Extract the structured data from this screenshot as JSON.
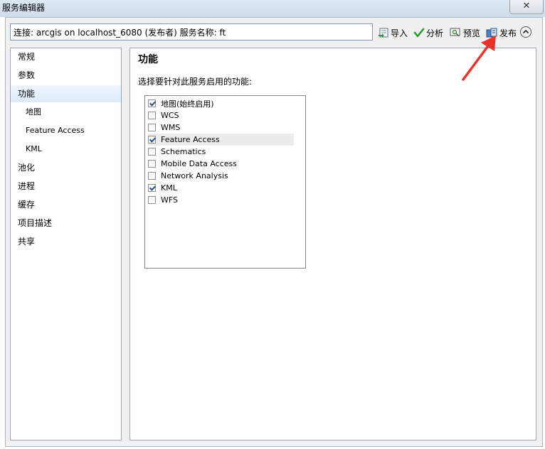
{
  "window": {
    "title": "服务编辑器",
    "close_glyph": "✕"
  },
  "toolbar": {
    "connection": "连接: arcgis on localhost_6080 (发布者)    服务名称: ft",
    "import_label": "导入",
    "analyze_label": "分析",
    "preview_label": "预览",
    "publish_label": "发布",
    "collapse_icon": "chevron-up-icon"
  },
  "nav": {
    "items": [
      {
        "label": "常规"
      },
      {
        "label": "参数"
      },
      {
        "label": "功能",
        "selected": true
      },
      {
        "label": "地图"
      },
      {
        "label": "Feature Access"
      },
      {
        "label": "KML"
      },
      {
        "label": "池化"
      },
      {
        "label": "进程"
      },
      {
        "label": "缓存"
      },
      {
        "label": "项目描述"
      },
      {
        "label": "共享"
      }
    ]
  },
  "content": {
    "title": "功能",
    "description": "选择要针对此服务启用的功能:",
    "capabilities": [
      {
        "label": "地图(始终启用)",
        "checked": true
      },
      {
        "label": "WCS",
        "checked": false
      },
      {
        "label": "WMS",
        "checked": false
      },
      {
        "label": "Feature Access",
        "checked": true,
        "highlighted": true
      },
      {
        "label": "Schematics",
        "checked": false
      },
      {
        "label": "Mobile Data Access",
        "checked": false
      },
      {
        "label": "Network Analysis",
        "checked": false
      },
      {
        "label": "KML",
        "checked": true
      },
      {
        "label": "WFS",
        "checked": false
      }
    ]
  },
  "colors": {
    "annotation_arrow": "#e8322a",
    "selection": "#dcebf9",
    "check": "#2b4f86"
  }
}
